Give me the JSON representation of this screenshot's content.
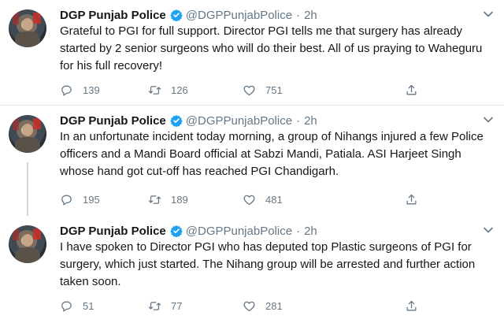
{
  "tweets": [
    {
      "name": "DGP Punjab Police",
      "handle": "@DGPPunjabPolice",
      "separator": "·",
      "time": "2h",
      "text": "Grateful to PGI for full support. Director PGI tells me that surgery has already started by 2 senior surgeons who will do their best. All of us praying to Waheguru for his full recovery!",
      "replies": "139",
      "retweets": "126",
      "likes": "751"
    },
    {
      "name": "DGP Punjab Police",
      "handle": "@DGPPunjabPolice",
      "separator": "·",
      "time": "2h",
      "text": "In an unfortunate incident today morning, a group of Nihangs injured a few Police officers and a Mandi Board official at Sabzi Mandi, Patiala. ASI Harjeet Singh whose hand got cut-off has reached PGI Chandigarh.",
      "replies": "195",
      "retweets": "189",
      "likes": "481"
    },
    {
      "name": "DGP Punjab Police",
      "handle": "@DGPPunjabPolice",
      "separator": "·",
      "time": "2h",
      "text": "I have spoken to Director PGI who has deputed top Plastic surgeons of PGI for surgery, which just started. The Nihang  group will be arrested and further action taken soon.",
      "replies": "51",
      "retweets": "77",
      "likes": "281"
    }
  ],
  "icons": {
    "verified": "verified-badge-icon",
    "caret": "chevron-down-icon",
    "reply": "reply-icon",
    "retweet": "retweet-icon",
    "like": "heart-icon",
    "share": "share-icon"
  },
  "colors": {
    "verified": "#1da1f2",
    "muted": "#657786",
    "text": "#14171a",
    "divider": "#e1e8ed",
    "thread_line": "#ccd6dd"
  }
}
